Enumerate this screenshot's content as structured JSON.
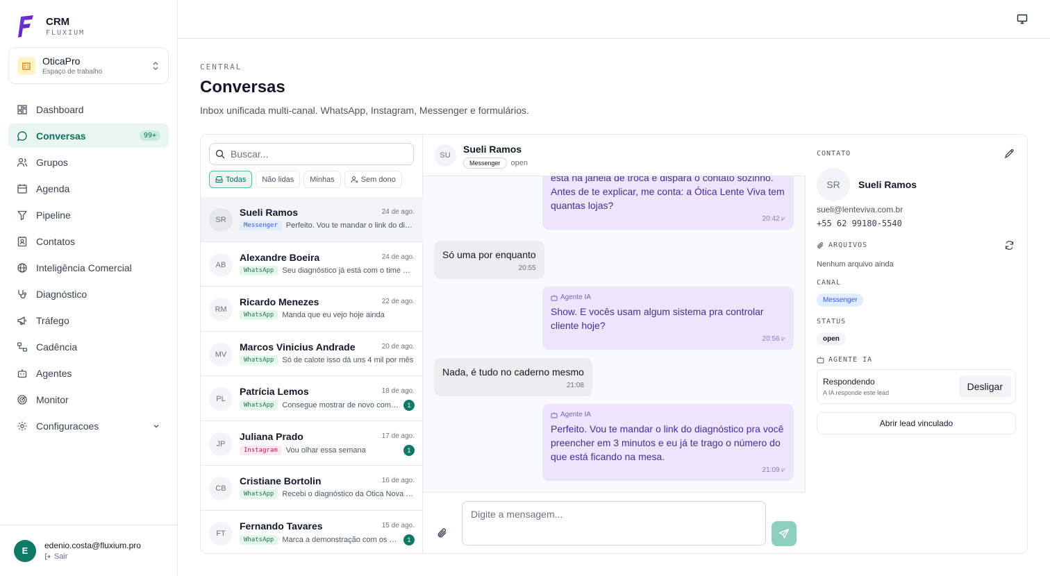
{
  "brand": {
    "title": "CRM",
    "subtitle": "FLUXIUM"
  },
  "workspace": {
    "name": "OticaPro",
    "subtitle": "Espaço de trabalho"
  },
  "nav": [
    {
      "label": "Dashboard",
      "icon": "dashboard-icon"
    },
    {
      "label": "Conversas",
      "icon": "chat-icon",
      "badge": "99+",
      "active": true
    },
    {
      "label": "Grupos",
      "icon": "users-icon"
    },
    {
      "label": "Agenda",
      "icon": "calendar-icon"
    },
    {
      "label": "Pipeline",
      "icon": "funnel-icon"
    },
    {
      "label": "Contatos",
      "icon": "contacts-icon"
    },
    {
      "label": "Inteligência Comercial",
      "icon": "globe-icon"
    },
    {
      "label": "Diagnóstico",
      "icon": "stethoscope-icon"
    },
    {
      "label": "Tráfego",
      "icon": "megaphone-icon"
    },
    {
      "label": "Cadência",
      "icon": "workflow-icon"
    },
    {
      "label": "Agentes",
      "icon": "bot-icon"
    },
    {
      "label": "Monitor",
      "icon": "radar-icon"
    },
    {
      "label": "Configuracoes",
      "icon": "gear-icon"
    }
  ],
  "user": {
    "initial": "E",
    "email": "edenio.costa@fluxium.pro",
    "logout": "Sair"
  },
  "header": {
    "section": "CENTRAL",
    "title": "Conversas",
    "description": "Inbox unificada multi-canal. WhatsApp, Instagram, Messenger e formulários."
  },
  "search": {
    "placeholder": "Buscar..."
  },
  "filters": [
    "Todas",
    "Não lidas",
    "Minhas",
    "Sem dono"
  ],
  "conversations": [
    {
      "initials": "SR",
      "name": "Sueli Ramos",
      "date": "24 de ago.",
      "channel": "Messenger",
      "preview": "Perfeito. Vou te mandar o link do diagnóstico pra você preencher",
      "unread": ""
    },
    {
      "initials": "AB",
      "name": "Alexandre Boeira",
      "date": "24 de ago.",
      "channel": "WhatsApp",
      "preview": "Seu diagnóstico já está com o time de especialistas",
      "unread": ""
    },
    {
      "initials": "RM",
      "name": "Ricardo Menezes",
      "date": "22 de ago.",
      "channel": "WhatsApp",
      "preview": "Manda que eu vejo hoje ainda",
      "unread": ""
    },
    {
      "initials": "MV",
      "name": "Marcos Vinicius Andrade",
      "date": "20 de ago.",
      "channel": "WhatsApp",
      "preview": "Só de calote isso dá uns 4 mil por mês",
      "unread": ""
    },
    {
      "initials": "PL",
      "name": "Patrícia Lemos",
      "date": "18 de ago.",
      "channel": "WhatsApp",
      "preview": "Consegue mostrar de novo como funciona?",
      "unread": "1"
    },
    {
      "initials": "JP",
      "name": "Juliana Prado",
      "date": "17 de ago.",
      "channel": "Instagram",
      "preview": "Vou olhar essa semana",
      "unread": "1"
    },
    {
      "initials": "CB",
      "name": "Cristiane Bortolin",
      "date": "16 de ago.",
      "channel": "WhatsApp",
      "preview": "Recebi o diagnóstico da Ótica Nova Visão",
      "unread": ""
    },
    {
      "initials": "FT",
      "name": "Fernando Tavares",
      "date": "15 de ago.",
      "channel": "WhatsApp",
      "preview": "Marca a demonstração com os sócios",
      "unread": "1"
    }
  ],
  "chat": {
    "initials": "SU",
    "name": "Sueli Ramos",
    "channel": "Messenger",
    "status": "open",
    "messages": [
      {
        "dir": "out",
        "text": "está na janela de troca e dispara o contato sozinho. Antes de te explicar, me conta: a Ótica Lente Viva tem quantas lojas?",
        "time": "20:42"
      },
      {
        "dir": "in",
        "text": "Só uma por enquanto",
        "time": "20:55"
      },
      {
        "dir": "out",
        "agent": "Agente IA",
        "text": "Show. E vocês usam algum sistema pra controlar cliente hoje?",
        "time": "20:56"
      },
      {
        "dir": "in",
        "text": "Nada, é tudo no caderno mesmo",
        "time": "21:08"
      },
      {
        "dir": "out",
        "agent": "Agente IA",
        "text": "Perfeito. Vou te mandar o link do diagnóstico pra você preencher em 3 minutos e eu já te trago o número do que está ficando na mesa.",
        "time": "21:09"
      }
    ],
    "composer_placeholder": "Digite a mensagem..."
  },
  "contact": {
    "label": "CONTATO",
    "initials": "SR",
    "name": "Sueli Ramos",
    "email": "sueli@lenteviva.com.br",
    "phone": "+55 62 99180-5540",
    "files_label": "ARQUIVOS",
    "files_empty": "Nenhum arquivo ainda",
    "channel_label": "CANAL",
    "channel": "Messenger",
    "status_label": "STATUS",
    "status": "open",
    "agent_label": "AGENTE IA",
    "agent_title": "Respondendo",
    "agent_sub": "A IA responde este lead",
    "agent_button": "Desligar",
    "lead_button": "Abrir lead vinculado"
  },
  "colors": {
    "accent": "#0f7a64",
    "accent_light": "#e8f5f1",
    "ai_bubble": "#ebe6fb",
    "brand": "#6d28d9"
  }
}
